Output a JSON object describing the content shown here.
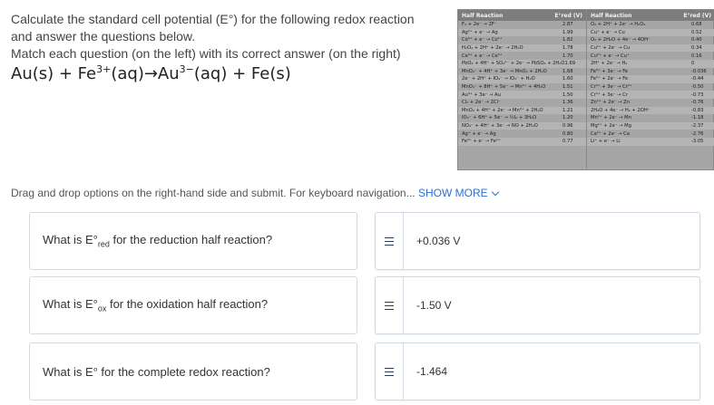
{
  "intro": {
    "line1": "Calculate the standard cell potential (E°) for the following redox reaction",
    "line2": "and answer the questions below.",
    "line3": "Match each question (on the left) with its correct answer (on the right)"
  },
  "reaction": {
    "lhs": "Au(s) + Fe",
    "fe_charge": "3+",
    "middle": "(aq)→Au",
    "au_charge": "3−",
    "rhs": "(aq) + Fe(s)"
  },
  "table": {
    "header_reaction": "Half Reaction",
    "header_value": "E°red (V)",
    "left_rows": [
      {
        "r": "F₂ + 2e⁻ → 2F⁻",
        "v": "2.87"
      },
      {
        "r": "Ag²⁺ + e⁻ → Ag",
        "v": "1.99"
      },
      {
        "r": "Co³⁺ + e⁻ → Co²⁺",
        "v": "1.82"
      },
      {
        "r": "H₂O₂ + 2H⁺ + 2e⁻ → 2H₂O",
        "v": "1.78"
      },
      {
        "r": "Ce⁴⁺ + e⁻ → Ce³⁺",
        "v": "1.70"
      },
      {
        "r": "PbO₂ + 4H⁺ + SO₄²⁻ + 2e⁻ → PbSO₄ + 2H₂O",
        "v": "1.69"
      },
      {
        "r": "MnO₄⁻ + 4H⁺ + 3e⁻ → MnO₂ + 2H₂O",
        "v": "1.68"
      },
      {
        "r": "2e⁻ + 2H⁺ + IO₄⁻ → IO₃⁻ + H₂O",
        "v": "1.60"
      },
      {
        "r": "MnO₄⁻ + 8H⁺ + 5e⁻ → Mn²⁺ + 4H₂O",
        "v": "1.51"
      },
      {
        "r": "Au³⁺ + 3e⁻ → Au",
        "v": "1.50"
      },
      {
        "r": "Cl₂ + 2e⁻ → 2Cl⁻",
        "v": "1.36"
      },
      {
        "r": "MnO₂ + 4H⁺ + 2e⁻ → Mn²⁺ + 2H₂O",
        "v": "1.21"
      },
      {
        "r": "IO₃⁻ + 6H⁺ + 5e⁻ → ½I₂ + 3H₂O",
        "v": "1.20"
      },
      {
        "r": "NO₃⁻ + 4H⁺ + 3e⁻ → NO + 2H₂O",
        "v": "0.96"
      },
      {
        "r": "Ag⁺ + e⁻ → Ag",
        "v": "0.80"
      },
      {
        "r": "Fe³⁺ + e⁻ → Fe²⁺",
        "v": "0.77"
      }
    ],
    "right_rows": [
      {
        "r": "O₂ + 2H⁺ + 2e⁻ → H₂O₂",
        "v": "0.68"
      },
      {
        "r": "Cu⁺ + e⁻ → Cu",
        "v": "0.52"
      },
      {
        "r": "O₂ + 2H₂O + 4e⁻ → 4OH⁻",
        "v": "0.40"
      },
      {
        "r": "Cu²⁺ + 2e⁻ → Cu",
        "v": "0.34"
      },
      {
        "r": "Cu²⁺ + e⁻ → Cu⁺",
        "v": "0.16"
      },
      {
        "r": "2H⁺ + 2e⁻ → H₂",
        "v": "0"
      },
      {
        "r": "Fe³⁺ + 3e⁻ → Fe",
        "v": "-0.036"
      },
      {
        "r": "Fe²⁺ + 2e⁻ → Fe",
        "v": "-0.44"
      },
      {
        "r": "Cr³⁺ + 3e⁻ → Cr²⁺",
        "v": "-0.50"
      },
      {
        "r": "Cr³⁺ + 3e⁻ → Cr",
        "v": "-0.73"
      },
      {
        "r": "Zn²⁺ + 2e⁻ → Zn",
        "v": "-0.76"
      },
      {
        "r": "2H₂O + 4e⁻ → H₂ + 2OH⁻",
        "v": "-0.83"
      },
      {
        "r": "Mn²⁺ + 2e⁻ → Mn",
        "v": "-1.18"
      },
      {
        "r": "Mg²⁺ + 2e⁻ → Mg",
        "v": "-2.37"
      },
      {
        "r": "Ca²⁺ + 2e⁻ → Ca",
        "v": "-2.76"
      },
      {
        "r": "Li⁺ + e⁻ → Li",
        "v": "-3.05"
      }
    ]
  },
  "hint": {
    "text": "Drag and drop options on the right-hand side and submit. For keyboard navigation...",
    "show_more": "SHOW MORE"
  },
  "questions": [
    {
      "pre": "What is E°",
      "sub": "red",
      "post": " for the reduction half reaction?"
    },
    {
      "pre": "What is E°",
      "sub": "ox",
      "post": " for the oxidation half reaction?"
    },
    {
      "pre": "What is E° for the complete redox reaction?",
      "sub": "",
      "post": ""
    }
  ],
  "answers": [
    "+0.036 V",
    "-1.50 V",
    "-1.464"
  ],
  "icons": {
    "drag_handle": "drag-handle-icon",
    "chevron": "chevron-down-icon"
  },
  "colors": {
    "link": "#2c6fd1",
    "table_bg": "#a6a6a6",
    "table_header": "#7d7d7d"
  }
}
